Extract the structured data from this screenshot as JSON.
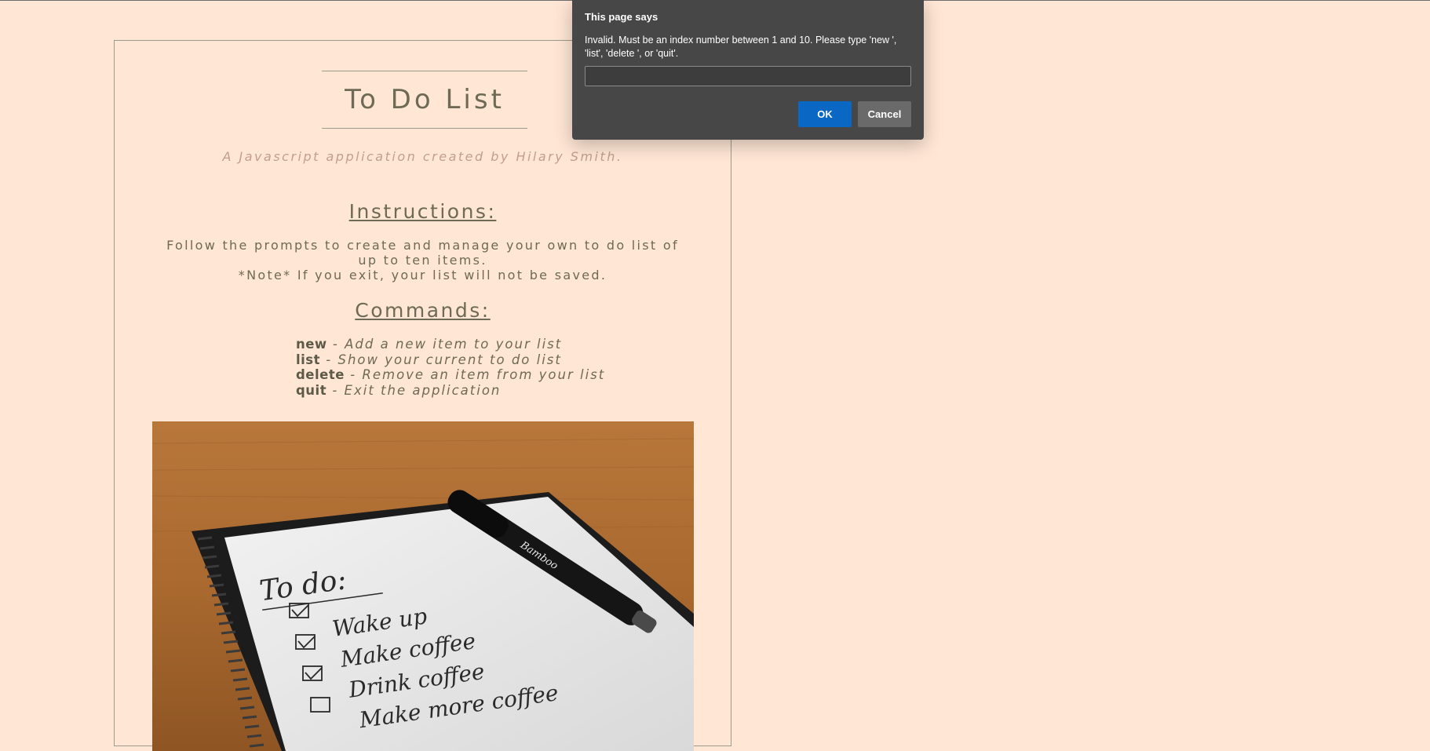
{
  "app": {
    "title": "To Do List",
    "subtitle": "A Javascript application created by Hilary Smith."
  },
  "instructions": {
    "heading": "Instructions:",
    "line1": "Follow the prompts to create and manage your own to do list of up to ten items.",
    "line2": "*Note* If you exit, your list will not be saved."
  },
  "commands": {
    "heading": "Commands:",
    "items": [
      {
        "key": "new",
        "desc": " - Add a new item to your list"
      },
      {
        "key": "list",
        "desc": " - Show your current to do list"
      },
      {
        "key": "delete",
        "desc": " - Remove an item from your list"
      },
      {
        "key": "quit",
        "desc": " - Exit the application"
      }
    ]
  },
  "photo": {
    "heading": "To do:",
    "items": [
      "Wake up",
      "Make coffee",
      "Drink coffee",
      "Make more coffee"
    ],
    "checked": [
      true,
      true,
      true,
      false
    ],
    "pen_brand": "Bamboo"
  },
  "dialog": {
    "title": "This page says",
    "message": "Invalid. Must be an index number between 1 and 10. Please type 'new ', 'list', 'delete ', or 'quit'.",
    "input_value": "",
    "ok_label": "OK",
    "cancel_label": "Cancel"
  },
  "colors": {
    "background": "#ffe6d5",
    "text": "#6e6a55",
    "subtitle": "#c39e8f",
    "dialog_bg": "#474747",
    "ok_button": "#0a68c4"
  }
}
